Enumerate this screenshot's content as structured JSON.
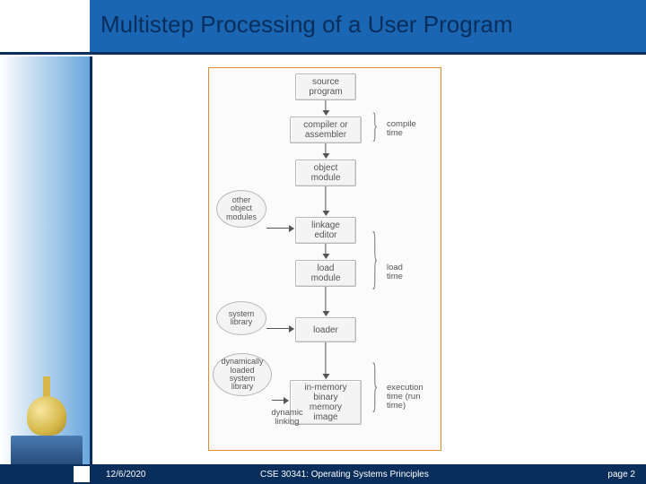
{
  "header": {
    "title": "Multistep Processing of a User Program"
  },
  "diagram": {
    "pipeline": [
      "source\nprogram",
      "compiler or\nassembler",
      "object\nmodule",
      "linkage\neditor",
      "load\nmodule",
      "loader",
      "in-memory\nbinary\nmemory\nimage"
    ],
    "side_inputs": {
      "other_object_modules": "other\nobject\nmodules",
      "system_library": "system\nlibrary",
      "dynamic_library": "dynamically\nloaded\nsystem\nlibrary"
    },
    "stage_labels": {
      "compile_time": "compile\ntime",
      "load_time": "load\ntime",
      "execution_time": "execution\ntime (run\ntime)"
    },
    "dynamic_linking_label": "dynamic\nlinking"
  },
  "footer": {
    "date": "12/6/2020",
    "course": "CSE 30341: Operating Systems Principles",
    "page": "page 2"
  }
}
